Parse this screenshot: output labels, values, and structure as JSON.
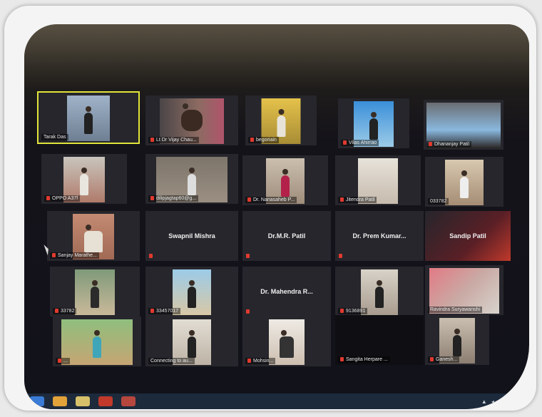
{
  "participants": [
    {
      "name": "Tarak Das",
      "active": true,
      "video": true,
      "muted": false
    },
    {
      "name": "Lt Dr Vijay Chau...",
      "video": true,
      "muted": true
    },
    {
      "name": "begoriain",
      "video": true,
      "muted": true
    },
    {
      "name": "Vilas Ahirrao",
      "video": true,
      "muted": true
    },
    {
      "name": "Dhananjay Patil",
      "video": true,
      "muted": true
    },
    {
      "name": "OPPO A37f",
      "video": true,
      "muted": true
    },
    {
      "name": "dilipjagtap60@g...",
      "video": true,
      "muted": true
    },
    {
      "name": "Dr. Nanasaheb P...",
      "video": true,
      "muted": true
    },
    {
      "name": "Jitendra Patil",
      "video": true,
      "muted": true
    },
    {
      "name": "033782",
      "video": true,
      "muted": false
    },
    {
      "name": "Sanjay Marathe...",
      "video": true,
      "muted": true
    },
    {
      "name": "Swapnil Mishra",
      "video": false,
      "muted": true
    },
    {
      "name": "Dr.M.R. Patil",
      "video": false,
      "muted": true
    },
    {
      "name": "Dr. Prem Kumar...",
      "video": false,
      "muted": true
    },
    {
      "name": "Sandip Patil",
      "video": false,
      "muted": false
    },
    {
      "name": "33782",
      "video": true,
      "muted": true
    },
    {
      "name": "33457017",
      "video": true,
      "muted": true
    },
    {
      "name": "Dr. Mahendra R...",
      "video": false,
      "muted": true
    },
    {
      "name": "9136891",
      "video": true,
      "muted": true
    },
    {
      "name": "Ravindra Suryawanshi",
      "video": true,
      "muted": false
    },
    {
      "name": "...",
      "video": true,
      "muted": true
    },
    {
      "name": "Connecting to au...",
      "video": true,
      "muted": false
    },
    {
      "name": "Mohsin...",
      "video": true,
      "muted": true
    },
    {
      "name": "Sangita Herpare ...",
      "video": false,
      "muted": true
    },
    {
      "name": "Ganesh...",
      "video": true,
      "muted": true
    }
  ],
  "taskbar": {
    "tray_text": "▲ ◂ ◉ ▣"
  },
  "colors": {
    "active_speaker_border": "#e1e43a",
    "muted_mic": "#e03a2f",
    "tile_bg": "#26262c"
  }
}
